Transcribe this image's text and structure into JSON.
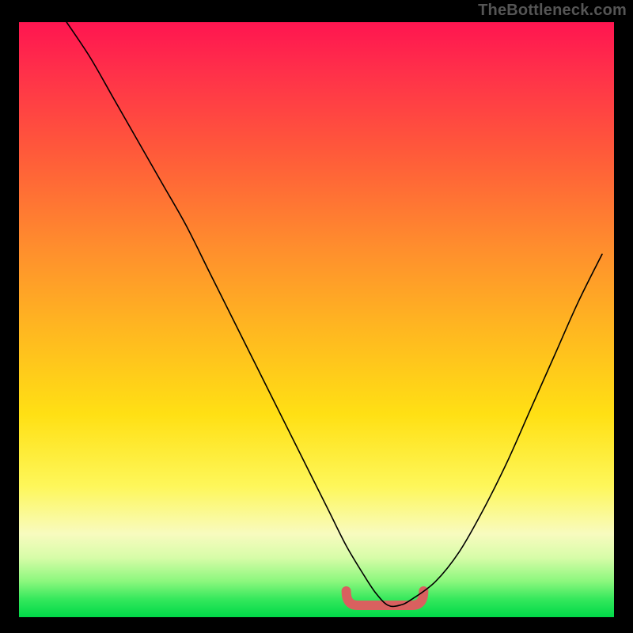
{
  "watermark": "TheBottleneck.com",
  "chart_data": {
    "type": "line",
    "title": "",
    "xlabel": "",
    "ylabel": "",
    "xlim": [
      0,
      100
    ],
    "ylim": [
      0,
      100
    ],
    "grid": false,
    "series": [
      {
        "name": "bottleneck-curve",
        "x": [
          8,
          12,
          16,
          20,
          24,
          28,
          32,
          36,
          40,
          44,
          48,
          52,
          55,
          58,
          60,
          62,
          64,
          66,
          70,
          74,
          78,
          82,
          86,
          90,
          94,
          98
        ],
        "values": [
          100,
          94,
          87,
          80,
          73,
          66,
          58,
          50,
          42,
          34,
          26,
          18,
          12,
          7,
          4,
          2,
          2,
          3,
          6,
          11,
          18,
          26,
          35,
          44,
          53,
          61
        ]
      }
    ],
    "highlight": {
      "name": "valley-marker",
      "x_range": [
        55,
        68
      ],
      "y": 2
    }
  },
  "colors": {
    "curve": "#000000",
    "highlight": "#d9605f",
    "gradient_top": "#ff1550",
    "gradient_bottom": "#00d948"
  }
}
